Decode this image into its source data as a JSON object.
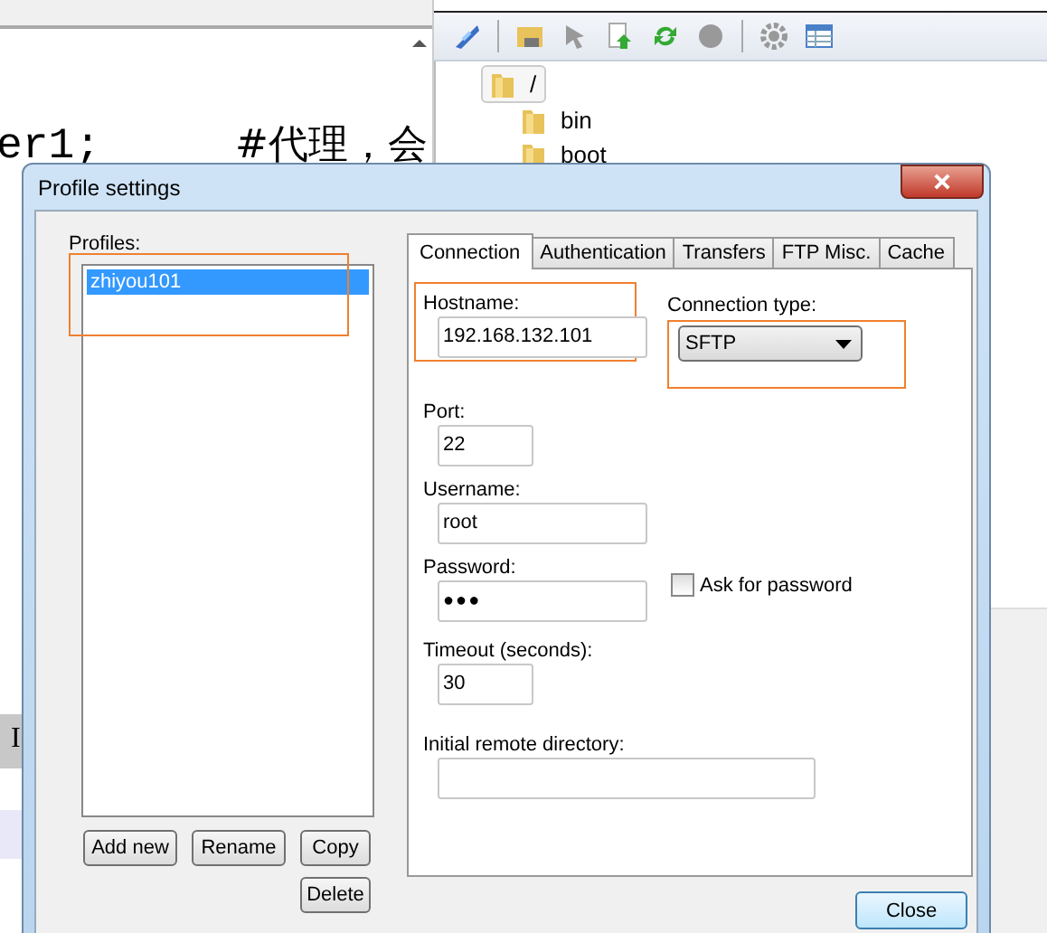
{
  "editor": {
    "code": "er1;",
    "comment": "#代理，会",
    "cursor_line": "I"
  },
  "file_tree": [
    {
      "label": "/",
      "selected": true,
      "children": [
        {
          "label": "bin",
          "selected": false
        },
        {
          "label": "boot",
          "selected": false
        }
      ]
    }
  ],
  "dialog": {
    "title": "Profile settings",
    "profiles_label": "Profiles:",
    "profiles_highlighted": true,
    "profiles": [
      {
        "name": "zhiyou101",
        "selected": true
      }
    ],
    "profile_buttons": [
      "Add new",
      "Rename",
      "Copy",
      "Delete"
    ],
    "tabs": [
      {
        "label": "Connection",
        "selected": true
      },
      {
        "label": "Authentication",
        "selected": false
      },
      {
        "label": "Transfers",
        "selected": false
      },
      {
        "label": "FTP Misc.",
        "selected": false
      },
      {
        "label": "Cache",
        "selected": false
      }
    ],
    "hostname": {
      "label": "Hostname:",
      "value": "192.168.132.101",
      "highlighted": true
    },
    "connection_type": {
      "label": "Connection type:",
      "value": "SFTP",
      "highlighted": true
    },
    "port": {
      "label": "Port:",
      "value": "22"
    },
    "username": {
      "label": "Username:",
      "value": "root"
    },
    "password": {
      "label": "Password:",
      "value": "●●●"
    },
    "ask_for_password": {
      "label": "Ask for password",
      "checked": false
    },
    "timeout": {
      "label": "Timeout (seconds):",
      "value": "30"
    },
    "initial_remote_directory": {
      "label": "Initial remote directory:"
    },
    "close_button": "Close"
  }
}
